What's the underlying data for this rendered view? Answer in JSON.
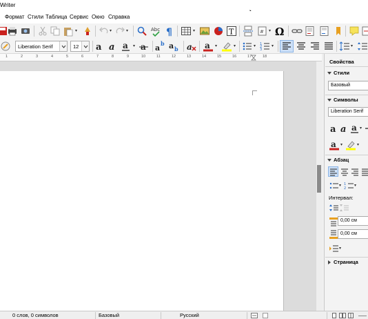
{
  "window": {
    "title": "Writer"
  },
  "menubar": {
    "items": [
      "Формат",
      "Стили",
      "Таблица",
      "Сервис",
      "Окно",
      "Справка"
    ]
  },
  "toolbar": {
    "paragraph_style": "",
    "font_name": "Liberation Serif",
    "font_size": "12"
  },
  "ruler": {
    "labels": [
      "1",
      "2",
      "3",
      "4",
      "5",
      "6",
      "7",
      "8",
      "9",
      "10",
      "11",
      "12",
      "13",
      "14",
      "15",
      "16",
      "17",
      "18"
    ]
  },
  "sidebar": {
    "title": "Свойства",
    "styles_header": "Стили",
    "style_value": "Базовый",
    "symbols_header": "Символы",
    "font_value": "Liberation Serif",
    "paragraph_header": "Абзац",
    "spacing_label": "Интервал:",
    "spacing_above": "0,00 см",
    "spacing_below": "0,00 см",
    "page_header": "Страница"
  },
  "statusbar": {
    "word_count": "0 слов, 0 символов",
    "page_style": "Базовый",
    "language": "Русский"
  },
  "colors": {
    "accent_blue": "#2a6fc9",
    "font_color_red": "#c9211e",
    "highlight_yellow": "#ffff00"
  }
}
